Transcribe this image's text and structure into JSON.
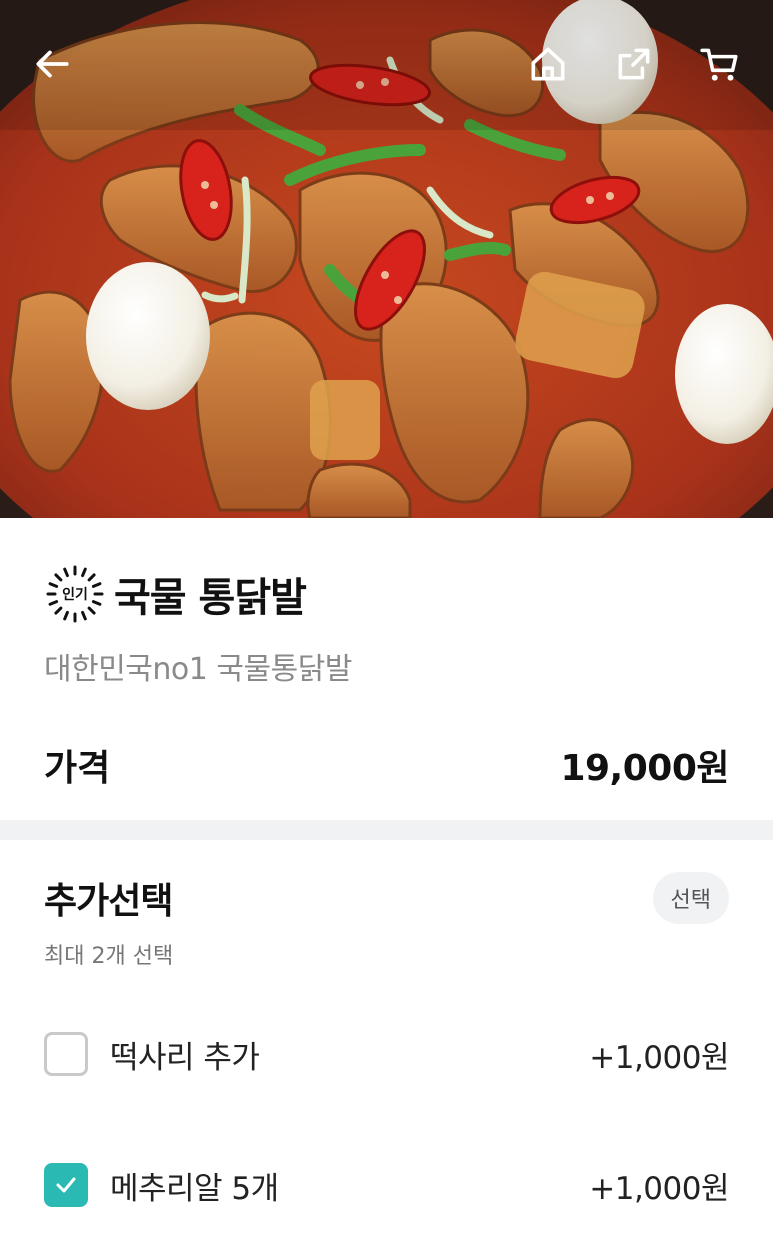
{
  "header": {
    "back_icon": "arrow-left-icon",
    "home_icon": "home-icon",
    "share_icon": "share-icon",
    "cart_icon": "cart-icon"
  },
  "menu": {
    "badge": "인기",
    "title": "국물 통닭발",
    "description": "대한민국no1 국물통닭발",
    "price_label": "가격",
    "price": "19,000원"
  },
  "options": {
    "title": "추가선택",
    "pill": "선택",
    "subtitle": "최대 2개 선택",
    "items": [
      {
        "label": "떡사리 추가",
        "price": "+1,000원",
        "checked": false
      },
      {
        "label": "메추리알 5개",
        "price": "+1,000원",
        "checked": true
      }
    ]
  },
  "colors": {
    "accent": "#2ab9b3",
    "divider": "#f1f2f4",
    "muted_text": "#8a8a8a"
  }
}
